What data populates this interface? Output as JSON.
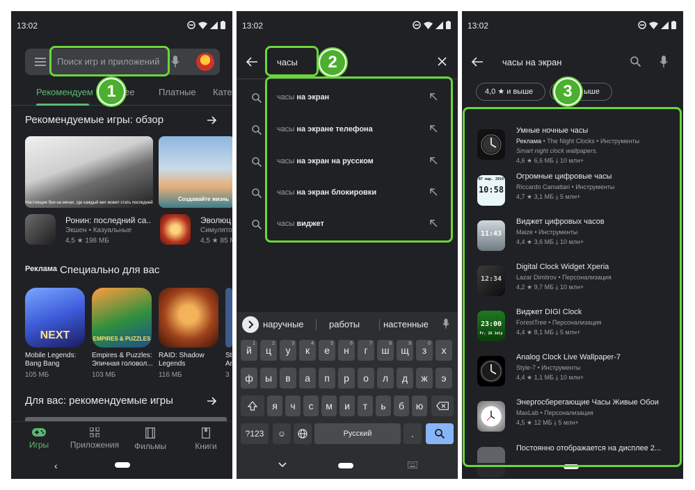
{
  "status": {
    "time": "13:02"
  },
  "screen1": {
    "search_placeholder": "Поиск игр и приложений",
    "tabs": [
      "Рекомендуем",
      "ее",
      "Платные",
      "Кате"
    ],
    "section1_title": "Рекомендуемые игры: обзор",
    "thumb1_caption": "Настоящие бои на мечах, где каждый миг может стать последней",
    "thumb2_caption": "Создавайте жизнь",
    "apps_row": [
      {
        "name": "Ронин: последний са...",
        "category": "Экшен • Казуальные",
        "stats": "4,5 ★  198 МБ"
      },
      {
        "name": "Эволюц",
        "category": "Симулятор",
        "stats": "4,5 ★  85 М"
      }
    ],
    "ad_label": "Реклама",
    "section2_title": "Специально для вас",
    "cards": [
      {
        "icon_label": "NEXT",
        "name": "Mobile Legends: Bang Bang",
        "size": "105 МБ"
      },
      {
        "icon_label": "EMPIRES & PUZZLES",
        "name": "Empires & Puzzles: Эпичная головол...",
        "size": "103 МБ"
      },
      {
        "icon_label": "",
        "name": "RAID: Shadow Legends",
        "size": "116 МБ"
      },
      {
        "icon_label": "",
        "name": "St Ar",
        "size": "3"
      }
    ],
    "section3_title": "Для вас: рекомендуемые игры",
    "bottom_nav": [
      "Игры",
      "Приложения",
      "Фильмы",
      "Книги"
    ]
  },
  "screen2": {
    "query": "часы",
    "suggestions": [
      {
        "prefix": "часы",
        "rest": " на экран"
      },
      {
        "prefix": "часы",
        "rest": " на экране телефона"
      },
      {
        "prefix": "часы",
        "rest": " на экран на русском"
      },
      {
        "prefix": "часы",
        "rest": " на экран блокировки"
      },
      {
        "prefix": "часы",
        "rest": " виджет"
      }
    ],
    "keyboard_suggestions": [
      "наручные",
      "работы",
      "настенные"
    ],
    "keyboard_rows": [
      [
        "й",
        "ц",
        "у",
        "к",
        "е",
        "н",
        "г",
        "ш",
        "щ",
        "з",
        "х"
      ],
      [
        "ф",
        "ы",
        "в",
        "а",
        "п",
        "р",
        "о",
        "л",
        "д",
        "ж",
        "э"
      ],
      [
        "я",
        "ч",
        "с",
        "м",
        "и",
        "т",
        "ь",
        "б",
        "ю"
      ]
    ],
    "key_hints": [
      "1",
      "2",
      "3",
      "4",
      "5",
      "6",
      "7",
      "8",
      "9",
      "0",
      ""
    ],
    "symbols_key": "?123",
    "space_key": "Русский",
    "period_key": "."
  },
  "screen3": {
    "query": "часы на экран",
    "chip_rating": "4,0 ★ и выше",
    "chip_second": "ыше",
    "results": [
      {
        "name": "Умные ночные часы",
        "developer_ad": "Реклама",
        "developer": "The Night Clocks",
        "category": "Инструменты",
        "extra": "Smart night clock wallpapers.",
        "rating": "4,6 ★",
        "size": "6,6 МБ",
        "installs": "10 млн+"
      },
      {
        "name": "Огромные цифровые часы",
        "developer_ad": "",
        "developer": "Riccardo Camattari",
        "category": "Инструменты",
        "extra": "",
        "rating": "4,7 ★",
        "size": "3,1 МБ",
        "installs": "5 млн+"
      },
      {
        "name": "Виджет цифровых часов",
        "developer_ad": "",
        "developer": "Maize",
        "category": "Инструменты",
        "extra": "",
        "rating": "4,4 ★",
        "size": "3,6 МБ",
        "installs": "10 млн+"
      },
      {
        "name": "Digital Clock Widget Xperia",
        "developer_ad": "",
        "developer": "Lazar Dimitrov",
        "category": "Персонализация",
        "extra": "",
        "rating": "4,2 ★",
        "size": "9,7 МБ",
        "installs": "10 млн+"
      },
      {
        "name": "Виджет DIGI Clock",
        "developer_ad": "",
        "developer": "ForestTree",
        "category": "Персонализация",
        "extra": "",
        "rating": "4,4 ★",
        "size": "8,1 МБ",
        "installs": "5 млн+"
      },
      {
        "name": "Analog Clock Live Wallpaper-7",
        "developer_ad": "",
        "developer": "Style-7",
        "category": "Инструменты",
        "extra": "",
        "rating": "4,4 ★",
        "size": "1,1 МБ",
        "installs": "10 млн+"
      },
      {
        "name": "Энергосберегающие Часы Живые Обои",
        "developer_ad": "",
        "developer": "MaxLab",
        "category": "Персонализация",
        "extra": "",
        "rating": "4,5 ★",
        "size": "12 МБ",
        "installs": "5 млн+"
      },
      {
        "name": "Постоянно отображается на дисплее 2...",
        "developer_ad": "",
        "developer": "",
        "category": "",
        "extra": "",
        "rating": "",
        "size": "",
        "installs": ""
      }
    ],
    "icon_texts": [
      "",
      "10:58",
      "11:43",
      "12:34",
      "23:00",
      "",
      "",
      ""
    ],
    "icon_subtexts": [
      "",
      "ВТ  мар. 2019",
      "",
      "",
      "Fr, 26 July",
      "",
      "",
      ""
    ]
  },
  "badges": [
    "1",
    "2",
    "3"
  ],
  "colors": {
    "accent": "#5bb974",
    "highlight": "#69d73b",
    "background": "#202124",
    "enter_key": "#8ab4f8"
  }
}
